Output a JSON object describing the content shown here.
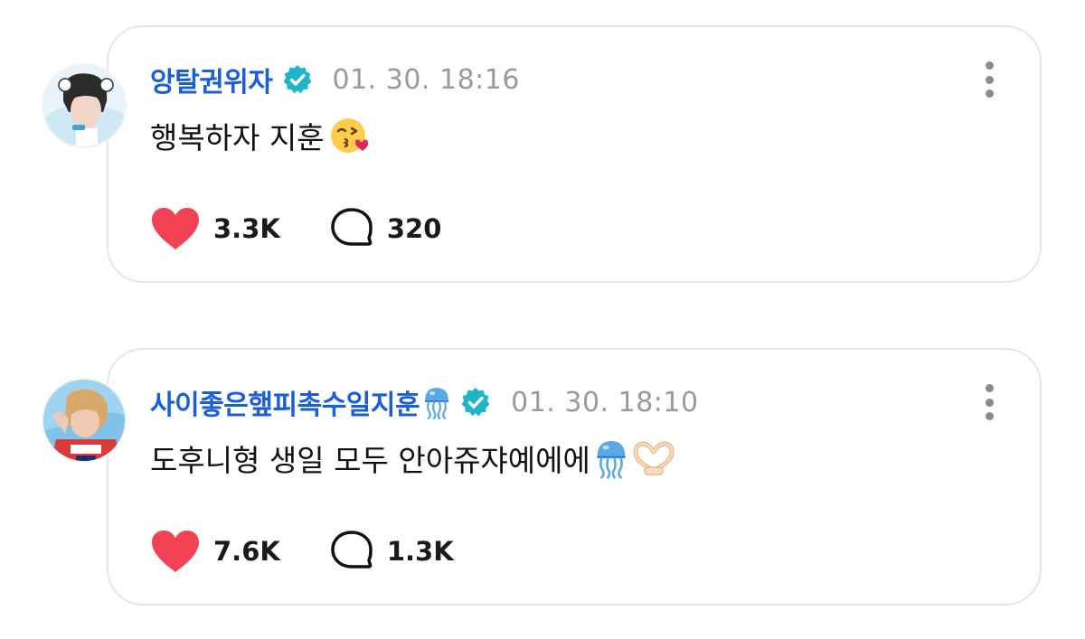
{
  "posts": [
    {
      "username": "앙탈권위자",
      "timestamp": "01. 30. 18:16",
      "content": "행복하자 지훈",
      "content_emojis": [
        "kissing-face-emoji"
      ],
      "likes": "3.3K",
      "comments": "320",
      "verified": true
    },
    {
      "username": "사이좋은햎피촉수일지훈",
      "timestamp": "01. 30. 18:10",
      "content": "도후니형 생일 모두 안아쥬쟈예에에",
      "content_emojis": [
        "jellyfish-emoji",
        "heart-hands-emoji"
      ],
      "likes": "7.6K",
      "comments": "1.3K",
      "verified": true
    }
  ],
  "colors": {
    "username": "#1a5fd8",
    "verified": "#1fb5c8",
    "heart": "#f24254",
    "timestamp": "#9a9a9a",
    "card_border": "#e6e6e6"
  }
}
